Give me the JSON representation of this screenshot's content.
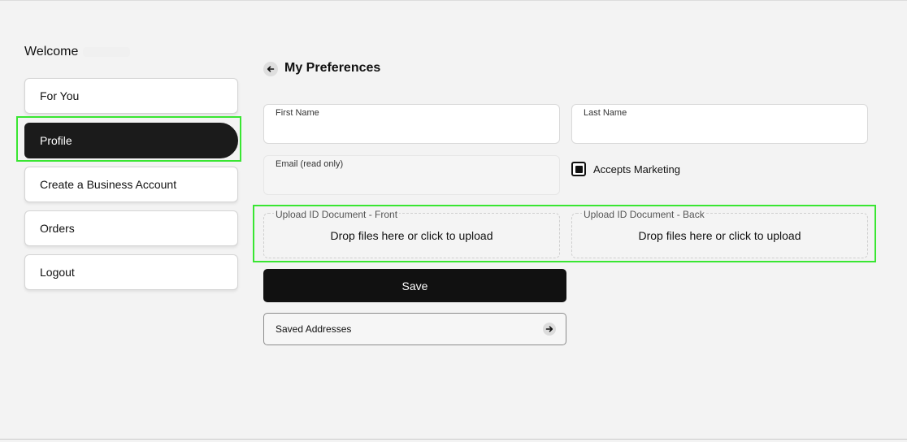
{
  "sidebar": {
    "welcome": "Welcome",
    "items": [
      {
        "label": "For You"
      },
      {
        "label": "Profile"
      },
      {
        "label": "Create a Business Account"
      },
      {
        "label": "Orders"
      },
      {
        "label": "Logout"
      }
    ]
  },
  "main": {
    "title": "My Preferences",
    "fields": {
      "first_name_label": "First Name",
      "last_name_label": "Last Name",
      "email_label": "Email (read only)"
    },
    "accepts_marketing": {
      "label": "Accepts Marketing",
      "checked": true
    },
    "uploads": {
      "front_label": "Upload ID Document - Front",
      "front_text": "Drop files here or click to upload",
      "back_label": "Upload ID Document - Back",
      "back_text": "Drop files here or click to upload"
    },
    "save_label": "Save",
    "saved_addresses_label": "Saved Addresses"
  },
  "icons": {
    "back": "arrow-left-icon",
    "addresses": "arrow-right-icon"
  },
  "colors": {
    "highlight": "#39e632",
    "primary": "#111111"
  }
}
